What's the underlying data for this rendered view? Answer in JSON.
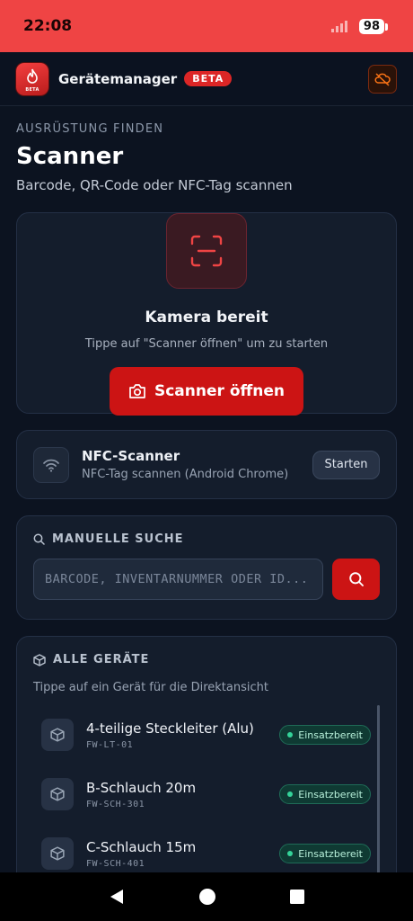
{
  "status_bar": {
    "time": "22:08",
    "battery": "98"
  },
  "app_bar": {
    "logo_badge": "BETA",
    "title": "Gerätemanager",
    "badge": "BETA"
  },
  "header": {
    "eyebrow": "AUSRÜSTUNG FINDEN",
    "title": "Scanner",
    "subtitle": "Barcode, QR-Code oder NFC-Tag scannen"
  },
  "scanner": {
    "status_title": "Kamera bereit",
    "hint": "Tippe auf \"Scanner öffnen\" um zu starten",
    "open_label": "Scanner öffnen"
  },
  "nfc": {
    "title": "NFC-Scanner",
    "subtitle": "NFC-Tag scannen (Android Chrome)",
    "start_label": "Starten"
  },
  "manual_search": {
    "heading": "MANUELLE SUCHE",
    "placeholder": "BARCODE, INVENTARNUMMER ODER ID..."
  },
  "devices": {
    "heading": "ALLE GERÄTE",
    "hint": "Tippe auf ein Gerät für die Direktansicht",
    "items": [
      {
        "name": "4-teilige Steckleiter (Alu)",
        "id": "FW-LT-01",
        "status": "Einsatzbereit"
      },
      {
        "name": "B-Schlauch 20m",
        "id": "FW-SCH-301",
        "status": "Einsatzbereit"
      },
      {
        "name": "C-Schlauch 15m",
        "id": "FW-SCH-401",
        "status": "Einsatzbereit"
      }
    ]
  },
  "colors": {
    "accent": "#cc1414",
    "status_ok": "#34d399",
    "background": "#0c1320"
  }
}
